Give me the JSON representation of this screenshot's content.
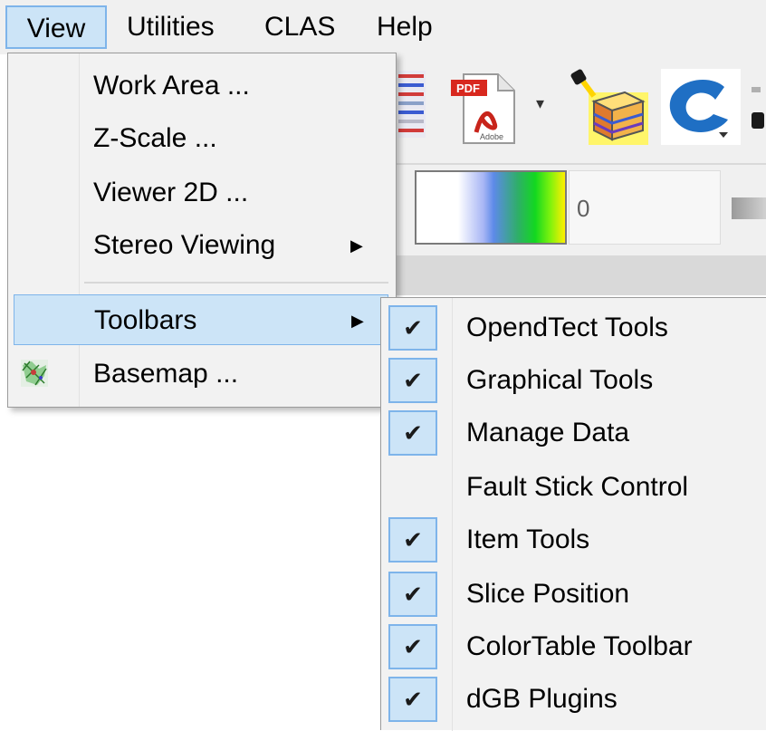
{
  "menubar": {
    "items": [
      "View",
      "Utilities",
      "CLAS",
      "Help"
    ],
    "active": "View"
  },
  "view_menu": {
    "items": [
      {
        "label": "Work Area ...",
        "submenu": false
      },
      {
        "label": "Z-Scale ...",
        "submenu": false
      },
      {
        "label": "Viewer 2D ...",
        "submenu": false
      },
      {
        "label": "Stereo Viewing",
        "submenu": true
      },
      {
        "label": "Toolbars",
        "submenu": true,
        "highlighted": true
      },
      {
        "label": "Basemap ...",
        "submenu": false,
        "icon": "basemap-icon"
      }
    ]
  },
  "toolbars_submenu": {
    "items": [
      {
        "label": "OpendTect Tools",
        "checked": true
      },
      {
        "label": "Graphical Tools",
        "checked": true
      },
      {
        "label": "Manage Data",
        "checked": true
      },
      {
        "label": "Fault Stick Control",
        "checked": false
      },
      {
        "label": "Item Tools",
        "checked": true
      },
      {
        "label": "Slice Position",
        "checked": true
      },
      {
        "label": "ColorTable Toolbar",
        "checked": true
      },
      {
        "label": "dGB Plugins",
        "checked": true
      }
    ]
  },
  "colortable": {
    "value": "0"
  },
  "toolbar_icons": [
    "table-icon",
    "pdf-icon",
    "dropdown-arrow-icon",
    "seismic-volume-icon",
    "c-logo-icon"
  ],
  "icon_glyphs": {
    "check": "✔",
    "submenu_arrow": "▶",
    "dropdown": "▾"
  },
  "colors": {
    "highlight_bg": "#cce4f7",
    "highlight_border": "#7eb4ea",
    "menu_bg": "#f2f2f2"
  }
}
